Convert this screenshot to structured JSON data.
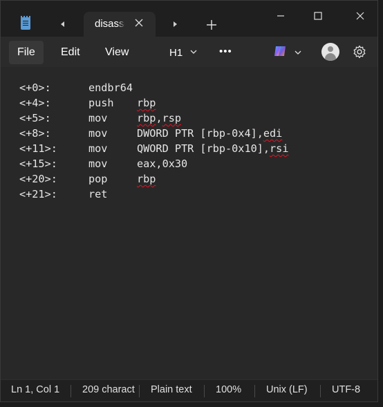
{
  "titlebar": {
    "tab_title": "disassemble",
    "icons": [
      "notepad-app-icon",
      "tab-scroll-left-icon",
      "close-icon",
      "tab-scroll-right-icon",
      "add-icon",
      "minimize-icon",
      "maximize-icon",
      "close-window-icon"
    ]
  },
  "menu": {
    "file": "File",
    "edit": "Edit",
    "view": "View",
    "heading": "H1",
    "more": "•••"
  },
  "code": [
    {
      "offset": "<+0>:",
      "op": "endbr64",
      "args": []
    },
    {
      "offset": "<+4>:",
      "op": "push",
      "args": [
        {
          "text": "rbp",
          "squiggle": true
        }
      ]
    },
    {
      "offset": "<+5>:",
      "op": "mov",
      "args": [
        {
          "text": "rbp",
          "squiggle": true
        },
        {
          "text": ",",
          "squiggle": false
        },
        {
          "text": "rsp",
          "squiggle": true
        }
      ]
    },
    {
      "offset": "<+8>:",
      "op": "mov",
      "args": [
        {
          "text": "DWORD PTR [rbp-0x4],",
          "squiggle": false
        },
        {
          "text": "edi",
          "squiggle": true
        }
      ]
    },
    {
      "offset": "<+11>:",
      "op": "mov",
      "args": [
        {
          "text": "QWORD PTR [rbp-0x10],",
          "squiggle": false
        },
        {
          "text": "rsi",
          "squiggle": true
        }
      ]
    },
    {
      "offset": "<+15>:",
      "op": "mov",
      "args": [
        {
          "text": "eax,0x30",
          "squiggle": false
        }
      ]
    },
    {
      "offset": "<+20>:",
      "op": "pop",
      "args": [
        {
          "text": "rbp",
          "squiggle": true
        }
      ]
    },
    {
      "offset": "<+21>:",
      "op": "ret",
      "args": []
    }
  ],
  "status": {
    "position": "Ln 1, Col 1",
    "characters": "209 charact",
    "format": "Plain text",
    "zoom": "100%",
    "line_ending": "Unix (LF)",
    "encoding": "UTF-8"
  },
  "colors": {
    "window_bg": "#202020",
    "editor_bg": "#282828",
    "menubar_bg": "#2b2b2b",
    "squiggle": "#e81123"
  }
}
